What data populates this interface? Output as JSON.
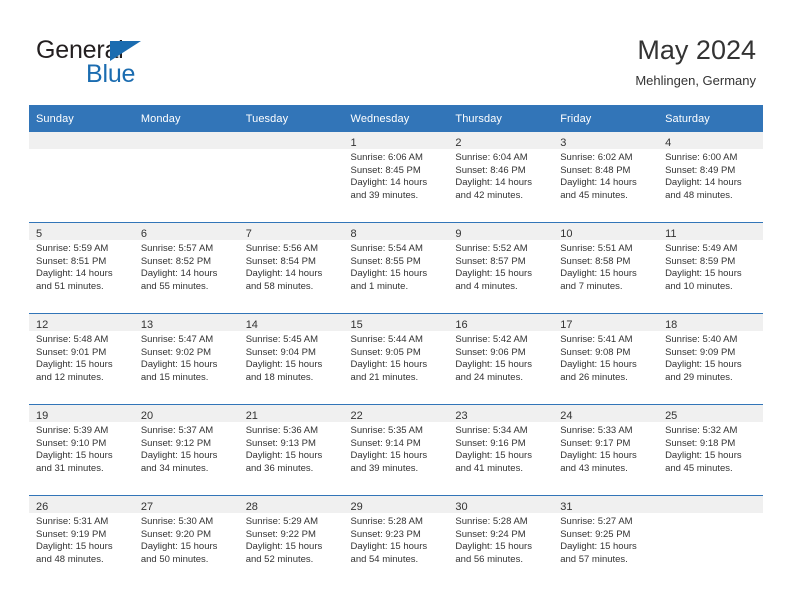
{
  "logo": {
    "word_top": "General",
    "word_bottom": "Blue",
    "triangle_icon": "blue-triangle-icon",
    "color_dark": "#231f20",
    "color_blue": "#1b6cb0"
  },
  "header": {
    "title": "May 2024",
    "subtitle": "Mehlingen, Germany"
  },
  "theme": {
    "header_bg": "#3275b8",
    "daynum_band_bg": "#f0f0f0",
    "row_divider": "#3275b8",
    "text": "#333333"
  },
  "calendar": {
    "weekday_headers": [
      "Sunday",
      "Monday",
      "Tuesday",
      "Wednesday",
      "Thursday",
      "Friday",
      "Saturday"
    ],
    "weeks": [
      [
        {
          "day": "",
          "lines": []
        },
        {
          "day": "",
          "lines": []
        },
        {
          "day": "",
          "lines": []
        },
        {
          "day": "1",
          "lines": [
            "Sunrise: 6:06 AM",
            "Sunset: 8:45 PM",
            "Daylight: 14 hours",
            "and 39 minutes."
          ]
        },
        {
          "day": "2",
          "lines": [
            "Sunrise: 6:04 AM",
            "Sunset: 8:46 PM",
            "Daylight: 14 hours",
            "and 42 minutes."
          ]
        },
        {
          "day": "3",
          "lines": [
            "Sunrise: 6:02 AM",
            "Sunset: 8:48 PM",
            "Daylight: 14 hours",
            "and 45 minutes."
          ]
        },
        {
          "day": "4",
          "lines": [
            "Sunrise: 6:00 AM",
            "Sunset: 8:49 PM",
            "Daylight: 14 hours",
            "and 48 minutes."
          ]
        }
      ],
      [
        {
          "day": "5",
          "lines": [
            "Sunrise: 5:59 AM",
            "Sunset: 8:51 PM",
            "Daylight: 14 hours",
            "and 51 minutes."
          ]
        },
        {
          "day": "6",
          "lines": [
            "Sunrise: 5:57 AM",
            "Sunset: 8:52 PM",
            "Daylight: 14 hours",
            "and 55 minutes."
          ]
        },
        {
          "day": "7",
          "lines": [
            "Sunrise: 5:56 AM",
            "Sunset: 8:54 PM",
            "Daylight: 14 hours",
            "and 58 minutes."
          ]
        },
        {
          "day": "8",
          "lines": [
            "Sunrise: 5:54 AM",
            "Sunset: 8:55 PM",
            "Daylight: 15 hours",
            "and 1 minute."
          ]
        },
        {
          "day": "9",
          "lines": [
            "Sunrise: 5:52 AM",
            "Sunset: 8:57 PM",
            "Daylight: 15 hours",
            "and 4 minutes."
          ]
        },
        {
          "day": "10",
          "lines": [
            "Sunrise: 5:51 AM",
            "Sunset: 8:58 PM",
            "Daylight: 15 hours",
            "and 7 minutes."
          ]
        },
        {
          "day": "11",
          "lines": [
            "Sunrise: 5:49 AM",
            "Sunset: 8:59 PM",
            "Daylight: 15 hours",
            "and 10 minutes."
          ]
        }
      ],
      [
        {
          "day": "12",
          "lines": [
            "Sunrise: 5:48 AM",
            "Sunset: 9:01 PM",
            "Daylight: 15 hours",
            "and 12 minutes."
          ]
        },
        {
          "day": "13",
          "lines": [
            "Sunrise: 5:47 AM",
            "Sunset: 9:02 PM",
            "Daylight: 15 hours",
            "and 15 minutes."
          ]
        },
        {
          "day": "14",
          "lines": [
            "Sunrise: 5:45 AM",
            "Sunset: 9:04 PM",
            "Daylight: 15 hours",
            "and 18 minutes."
          ]
        },
        {
          "day": "15",
          "lines": [
            "Sunrise: 5:44 AM",
            "Sunset: 9:05 PM",
            "Daylight: 15 hours",
            "and 21 minutes."
          ]
        },
        {
          "day": "16",
          "lines": [
            "Sunrise: 5:42 AM",
            "Sunset: 9:06 PM",
            "Daylight: 15 hours",
            "and 24 minutes."
          ]
        },
        {
          "day": "17",
          "lines": [
            "Sunrise: 5:41 AM",
            "Sunset: 9:08 PM",
            "Daylight: 15 hours",
            "and 26 minutes."
          ]
        },
        {
          "day": "18",
          "lines": [
            "Sunrise: 5:40 AM",
            "Sunset: 9:09 PM",
            "Daylight: 15 hours",
            "and 29 minutes."
          ]
        }
      ],
      [
        {
          "day": "19",
          "lines": [
            "Sunrise: 5:39 AM",
            "Sunset: 9:10 PM",
            "Daylight: 15 hours",
            "and 31 minutes."
          ]
        },
        {
          "day": "20",
          "lines": [
            "Sunrise: 5:37 AM",
            "Sunset: 9:12 PM",
            "Daylight: 15 hours",
            "and 34 minutes."
          ]
        },
        {
          "day": "21",
          "lines": [
            "Sunrise: 5:36 AM",
            "Sunset: 9:13 PM",
            "Daylight: 15 hours",
            "and 36 minutes."
          ]
        },
        {
          "day": "22",
          "lines": [
            "Sunrise: 5:35 AM",
            "Sunset: 9:14 PM",
            "Daylight: 15 hours",
            "and 39 minutes."
          ]
        },
        {
          "day": "23",
          "lines": [
            "Sunrise: 5:34 AM",
            "Sunset: 9:16 PM",
            "Daylight: 15 hours",
            "and 41 minutes."
          ]
        },
        {
          "day": "24",
          "lines": [
            "Sunrise: 5:33 AM",
            "Sunset: 9:17 PM",
            "Daylight: 15 hours",
            "and 43 minutes."
          ]
        },
        {
          "day": "25",
          "lines": [
            "Sunrise: 5:32 AM",
            "Sunset: 9:18 PM",
            "Daylight: 15 hours",
            "and 45 minutes."
          ]
        }
      ],
      [
        {
          "day": "26",
          "lines": [
            "Sunrise: 5:31 AM",
            "Sunset: 9:19 PM",
            "Daylight: 15 hours",
            "and 48 minutes."
          ]
        },
        {
          "day": "27",
          "lines": [
            "Sunrise: 5:30 AM",
            "Sunset: 9:20 PM",
            "Daylight: 15 hours",
            "and 50 minutes."
          ]
        },
        {
          "day": "28",
          "lines": [
            "Sunrise: 5:29 AM",
            "Sunset: 9:22 PM",
            "Daylight: 15 hours",
            "and 52 minutes."
          ]
        },
        {
          "day": "29",
          "lines": [
            "Sunrise: 5:28 AM",
            "Sunset: 9:23 PM",
            "Daylight: 15 hours",
            "and 54 minutes."
          ]
        },
        {
          "day": "30",
          "lines": [
            "Sunrise: 5:28 AM",
            "Sunset: 9:24 PM",
            "Daylight: 15 hours",
            "and 56 minutes."
          ]
        },
        {
          "day": "31",
          "lines": [
            "Sunrise: 5:27 AM",
            "Sunset: 9:25 PM",
            "Daylight: 15 hours",
            "and 57 minutes."
          ]
        },
        {
          "day": "",
          "lines": []
        }
      ]
    ]
  }
}
